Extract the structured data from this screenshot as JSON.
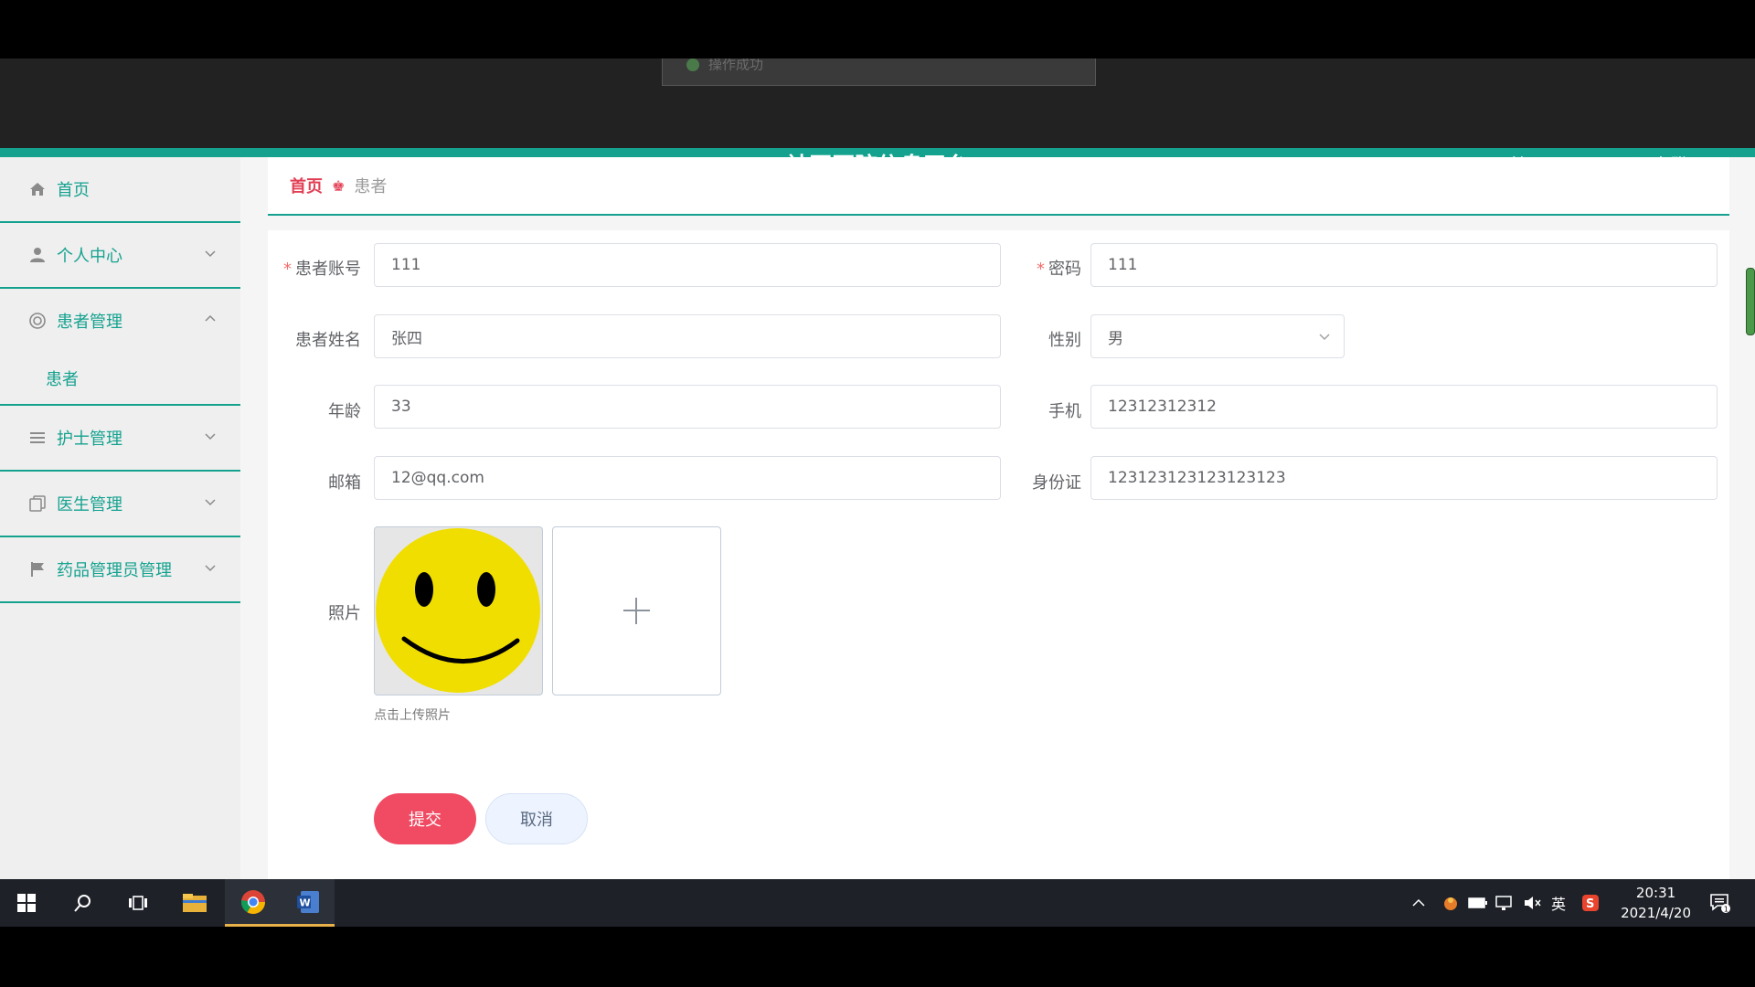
{
  "header": {
    "title": "社区医院信息平台",
    "user": "管理员 abo",
    "logout": "退出登录",
    "toast": "操作成功"
  },
  "sidebar": {
    "items": [
      {
        "label": "首页",
        "icon": "home-icon"
      },
      {
        "label": "个人中心",
        "icon": "user-icon"
      },
      {
        "label": "患者管理",
        "icon": "patient-icon",
        "expanded": true,
        "children": [
          "患者"
        ]
      },
      {
        "label": "护士管理",
        "icon": "list-icon"
      },
      {
        "label": "医生管理",
        "icon": "copy-icon"
      },
      {
        "label": "药品管理员管理",
        "icon": "flag-icon"
      }
    ]
  },
  "breadcrumb": {
    "home": "首页",
    "current": "患者"
  },
  "form": {
    "account": {
      "label": "患者账号",
      "value": "111",
      "required": true
    },
    "password": {
      "label": "密码",
      "value": "111",
      "required": true
    },
    "name": {
      "label": "患者姓名",
      "value": "张四"
    },
    "gender": {
      "label": "性别",
      "value": "男"
    },
    "age": {
      "label": "年龄",
      "value": "33"
    },
    "phone": {
      "label": "手机",
      "value": "12312312312"
    },
    "email": {
      "label": "邮箱",
      "value": "12@qq.com"
    },
    "idcard": {
      "label": "身份证",
      "value": "123123123123123123"
    },
    "photo": {
      "label": "照片",
      "tip": "点击上传照片"
    },
    "submit": "提交",
    "cancel": "取消"
  },
  "taskbar": {
    "ime": "英",
    "time": "20:31",
    "date": "2021/4/20",
    "notifications": "1"
  },
  "colors": {
    "accent": "#14a28f",
    "danger": "#f04b63",
    "header": "#222222"
  }
}
